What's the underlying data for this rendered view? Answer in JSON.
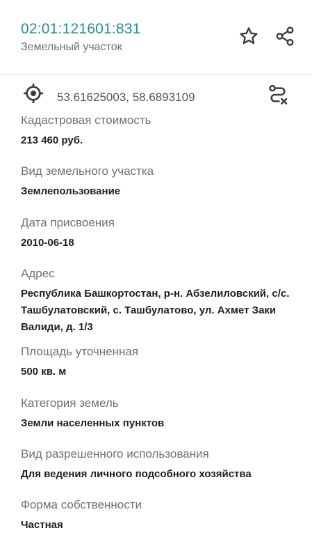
{
  "header": {
    "title": "02:01:121601:831",
    "subtitle": "Земельный участок"
  },
  "coords": {
    "text": "53.61625003, 58.6893109"
  },
  "fields": [
    {
      "label": "Кадастровая стоимость",
      "value": "213 460 руб."
    },
    {
      "label": "Вид земельного участка",
      "value": "Землепользование"
    },
    {
      "label": "Дата присвоения",
      "value": "2010-06-18"
    },
    {
      "label": "Адрес",
      "value": "Республика Башкортостан, р-н. Абзелиловский, с/с. Ташбулатовский, с. Ташбулатово, ул. Ахмет Заки Валиди, д. 1/3"
    },
    {
      "label": "Площадь уточненная",
      "value": "500 кв. м"
    },
    {
      "label": "Категория земель",
      "value": "Земли населенных пунктов"
    },
    {
      "label": "Вид разрешенного использования",
      "value": "Для ведения личного подсобного хозяйства"
    },
    {
      "label": "Форма собственности",
      "value": "Частная"
    }
  ],
  "icons": {
    "favorite": "star-icon",
    "share": "share-icon",
    "location": "target-icon",
    "route": "route-icon"
  },
  "colors": {
    "title": "#2a8c92",
    "label": "#707070",
    "value": "#1f1f1f"
  }
}
